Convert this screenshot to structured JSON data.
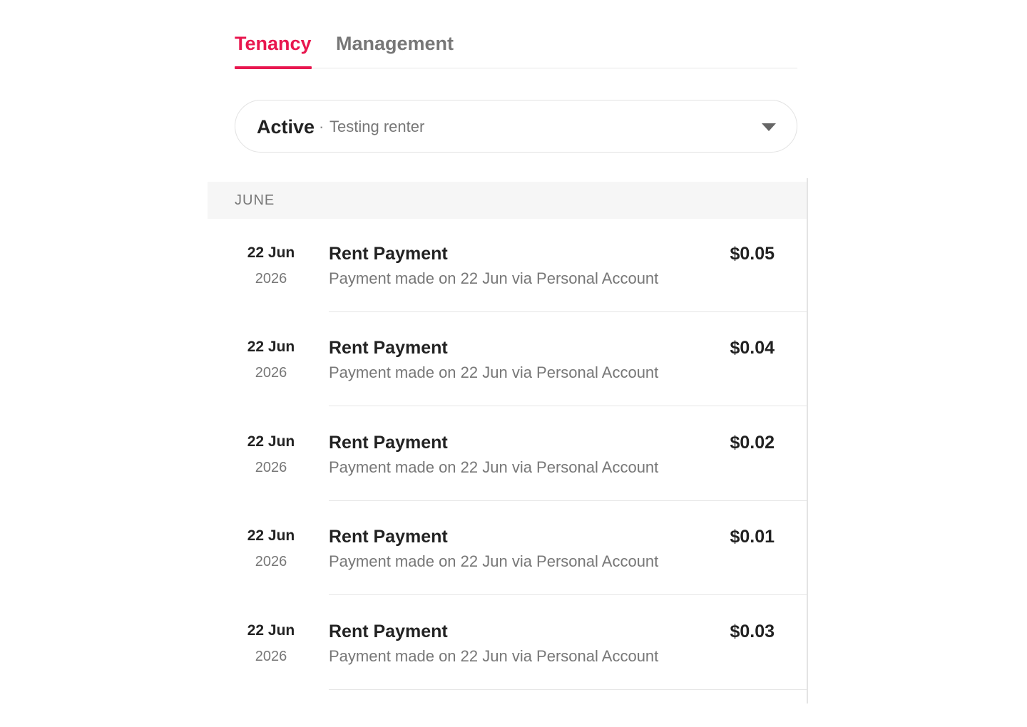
{
  "tabs": [
    {
      "label": "Tenancy",
      "active": true
    },
    {
      "label": "Management",
      "active": false
    }
  ],
  "accent_color": "#e8174f",
  "tenancy_selector": {
    "status": "Active",
    "separator": "·",
    "tenant": "Testing renter",
    "icon": "chevron-down-icon"
  },
  "month_group": {
    "label": "JUNE"
  },
  "transactions": [
    {
      "day": "22 Jun",
      "year": "2026",
      "title": "Rent Payment",
      "description": "Payment made on 22 Jun via Personal Account",
      "amount": "$0.05"
    },
    {
      "day": "22 Jun",
      "year": "2026",
      "title": "Rent Payment",
      "description": "Payment made on 22 Jun via Personal Account",
      "amount": "$0.04"
    },
    {
      "day": "22 Jun",
      "year": "2026",
      "title": "Rent Payment",
      "description": "Payment made on 22 Jun via Personal Account",
      "amount": "$0.02"
    },
    {
      "day": "22 Jun",
      "year": "2026",
      "title": "Rent Payment",
      "description": "Payment made on 22 Jun via Personal Account",
      "amount": "$0.01"
    },
    {
      "day": "22 Jun",
      "year": "2026",
      "title": "Rent Payment",
      "description": "Payment made on 22 Jun via Personal Account",
      "amount": "$0.03"
    }
  ]
}
